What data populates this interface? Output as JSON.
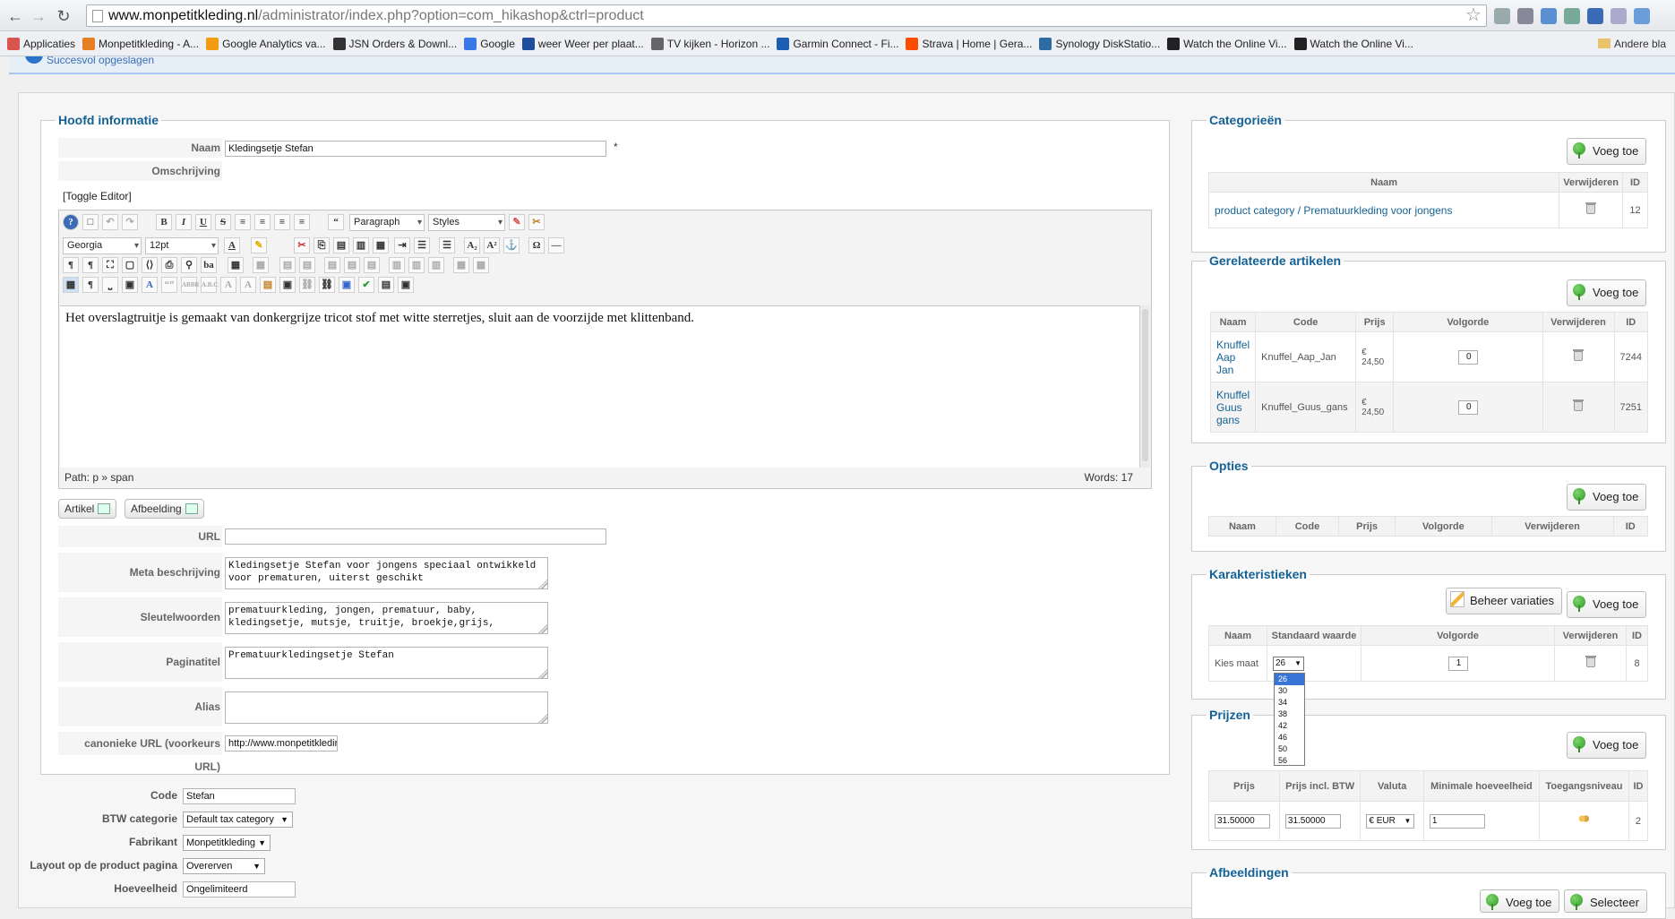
{
  "browser": {
    "url_host": "www.monpetitkleding.nl",
    "url_path": "/administrator/index.php?option=com_hikashop&ctrl=product",
    "bookmarks": [
      {
        "label": "Applicaties",
        "color": "#d9534f"
      },
      {
        "label": "Monpetitkleding - A...",
        "color": "#e67e22"
      },
      {
        "label": "Google Analytics va...",
        "color": "#f39c12"
      },
      {
        "label": "JSN Orders & Downl...",
        "color": "#333333"
      },
      {
        "label": "Google",
        "color": "#3b78e7"
      },
      {
        "label": "weer Weer per plaat...",
        "color": "#1f4e9c"
      },
      {
        "label": "TV kijken - Horizon ...",
        "color": "#666666"
      },
      {
        "label": "Garmin Connect - Fi...",
        "color": "#1a5fb4"
      },
      {
        "label": "Strava | Home | Gera...",
        "color": "#fc4c02"
      },
      {
        "label": "Synology DiskStatio...",
        "color": "#2d6ca2"
      },
      {
        "label": "Watch the Online Vi...",
        "color": "#222222"
      },
      {
        "label": "Watch the Online Vi...",
        "color": "#222222"
      }
    ],
    "other_bookmarks": "Andere bla"
  },
  "message": "Succesvol opgeslagen",
  "main": {
    "legend": "Hoofd informatie",
    "naam_label": "Naam",
    "naam_value": "Kledingsetje Stefan",
    "required_mark": "*",
    "omschrijving_label": "Omschrijving",
    "toggle_editor": "[Toggle Editor]",
    "editor": {
      "font": "Georgia",
      "size": "12pt",
      "format": "Paragraph",
      "styles": "Styles",
      "content": "Het overslagtruitje is gemaakt van donkergrijze tricot stof met witte sterretjes, sluit aan de voorzijde met klittenband.",
      "path": "Path:  p » span",
      "words": "Words: 17"
    },
    "artikel_btn": "Artikel",
    "afbeelding_btn": "Afbeelding",
    "url_label": "URL",
    "url_value": "",
    "meta_label": "Meta beschrijving",
    "meta_value": "Kledingsetje Stefan voor jongens speciaal ontwikkeld voor prematuren, uiterst geschikt",
    "keywords_label": "Sleutelwoorden",
    "keywords_value": "prematuurkleding, jongen, prematuur, baby, kledingsetje, mutsje, truitje, broekje,grijs,",
    "page_title_label": "Paginatitel",
    "page_title_value": "Prematuurkledingsetje Stefan",
    "alias_label": "Alias",
    "alias_value": "",
    "canonical_label": "canonieke URL (voorkeurs URL)",
    "canonical_value": "http://www.monpetitkledir"
  },
  "lower": {
    "code_label": "Code",
    "code_value": "Stefan",
    "btw_label": "BTW categorie",
    "btw_value": "Default tax category",
    "fabrikant_label": "Fabrikant",
    "fabrikant_value": "Monpetitkleding",
    "layout_label": "Layout op de product pagina",
    "layout_value": "Overerven",
    "hoeveelheid_label": "Hoeveelheid",
    "hoeveelheid_value": "Ongelimiteerd"
  },
  "right": {
    "add_label": "Voeg toe",
    "categories": {
      "legend": "Categorieën",
      "headers": [
        "Naam",
        "Verwijderen",
        "ID"
      ],
      "rows": [
        {
          "name": "product category / Prematuurkleding voor jongens",
          "id": "12"
        }
      ]
    },
    "related": {
      "legend": "Gerelateerde artikelen",
      "headers": [
        "Naam",
        "Code",
        "Prijs",
        "Volgorde",
        "Verwijderen",
        "ID"
      ],
      "rows": [
        {
          "name": "Knuffel Aap Jan",
          "code": "Knuffel_Aap_Jan",
          "price": "€ 24,50",
          "order": "0",
          "id": "7244"
        },
        {
          "name": "Knuffel Guus gans",
          "code": "Knuffel_Guus_gans",
          "price": "€ 24,50",
          "order": "0",
          "id": "7251"
        }
      ]
    },
    "options": {
      "legend": "Opties",
      "headers": [
        "Naam",
        "Code",
        "Prijs",
        "Volgorde",
        "Verwijderen",
        "ID"
      ]
    },
    "characteristics": {
      "legend": "Karakteristieken",
      "manage_label": "Beheer variaties",
      "headers": [
        "Naam",
        "Standaard waarde",
        "Volgorde",
        "Verwijderen",
        "ID"
      ],
      "row": {
        "name": "Kies maat",
        "selected": "26",
        "order": "1",
        "id": "8"
      },
      "dropdown_options": [
        "26",
        "30",
        "34",
        "38",
        "42",
        "46",
        "50",
        "56"
      ]
    },
    "prices": {
      "legend": "Prijzen",
      "headers": [
        "Prijs",
        "Prijs incl. BTW",
        "Valuta",
        "Minimale hoeveelheid",
        "Toegangsniveau",
        "ID"
      ],
      "row": {
        "price": "31.50000",
        "price_incl": "31.50000",
        "currency": "€ EUR",
        "min_qty": "1",
        "id": "2"
      }
    },
    "images": {
      "legend": "Afbeeldingen",
      "select_label": "Selecteer"
    }
  }
}
